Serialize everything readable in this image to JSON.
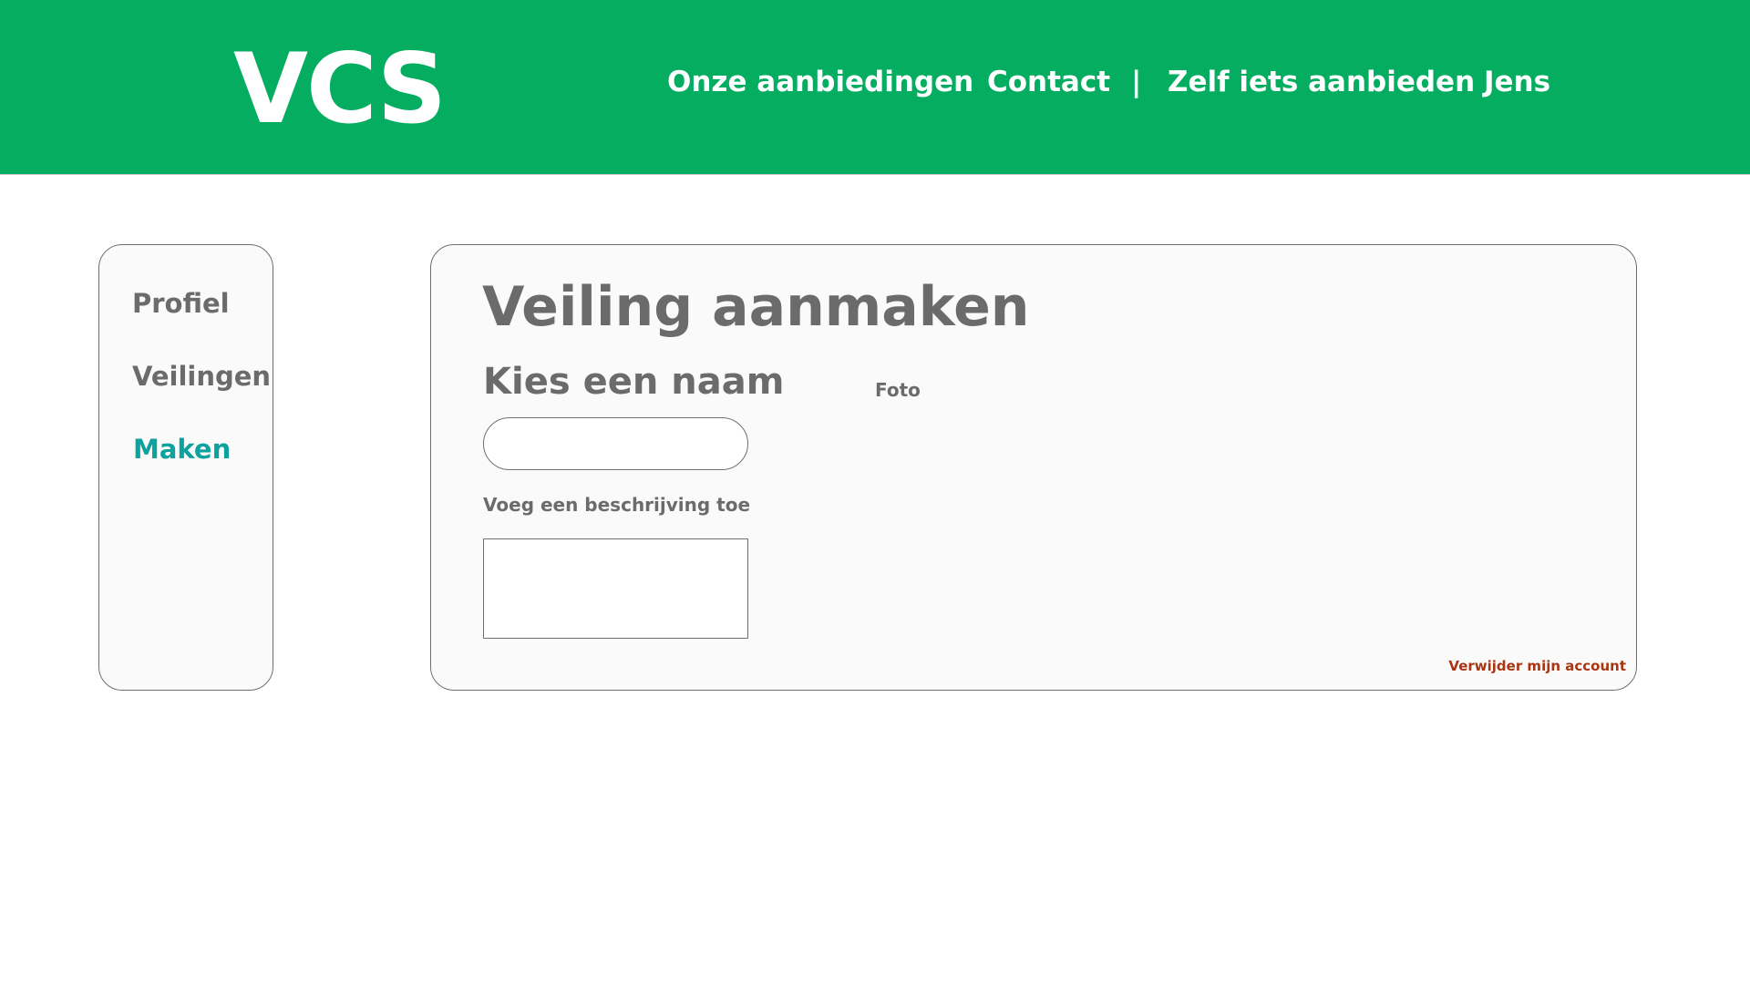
{
  "header": {
    "logo": "VCS",
    "nav": {
      "offers": "Onze aanbiedingen",
      "contact": "Contact",
      "separator": "|",
      "sell": "Zelf iets aanbieden",
      "user": "Jens"
    }
  },
  "sidebar": {
    "items": [
      {
        "label": "Profiel",
        "active": false
      },
      {
        "label": "Veilingen",
        "active": false
      },
      {
        "label": "Maken",
        "active": true
      }
    ]
  },
  "main": {
    "title": "Veiling aanmaken",
    "name_label": "Kies een naam",
    "name_value": "",
    "description_label": "Voeg een beschrijving toe",
    "description_value": "",
    "photo_label": "Foto",
    "delete_account": "Verwijder mijn account"
  },
  "colors": {
    "header_bg": "#05ad61",
    "active_nav": "#0ea29e",
    "text_gray": "#6b6b6b",
    "danger": "#a93512",
    "panel_bg": "#fafafa"
  }
}
